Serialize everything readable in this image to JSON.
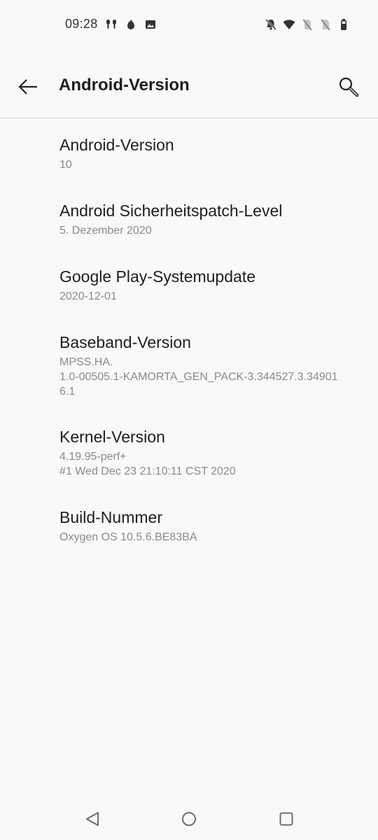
{
  "status_bar": {
    "time": "09:28",
    "left_icons": [
      "earbuds-icon",
      "fire-icon",
      "image-icon"
    ],
    "right_icons": [
      "bell-off-icon",
      "wifi-icon",
      "no-sim-icon",
      "no-sim-icon",
      "battery-icon"
    ]
  },
  "app_bar": {
    "title": "Android-Version"
  },
  "items": [
    {
      "title": "Android-Version",
      "summary": "10"
    },
    {
      "title": "Android Sicherheitspatch-Level",
      "summary": "5. Dezember 2020"
    },
    {
      "title": "Google Play-Systemupdate",
      "summary": "2020-12-01"
    },
    {
      "title": "Baseband-Version",
      "summary_line1": "MPSS.HA.",
      "summary_line2": "1.0-00505.1-KAMORTA_GEN_PACK-3.344527.3.34901",
      "summary_line3": "6.1"
    },
    {
      "title": "Kernel-Version",
      "summary_line1": "4.19.95-perf+",
      "summary_line2": "#1 Wed Dec 23 21:10:11 CST 2020"
    },
    {
      "title": "Build-Nummer",
      "summary": "Oxygen OS 10.5.6.BE83BA"
    }
  ],
  "nav_bar": {
    "icons": [
      "back-triangle-icon",
      "home-circle-icon",
      "recents-square-icon"
    ]
  }
}
